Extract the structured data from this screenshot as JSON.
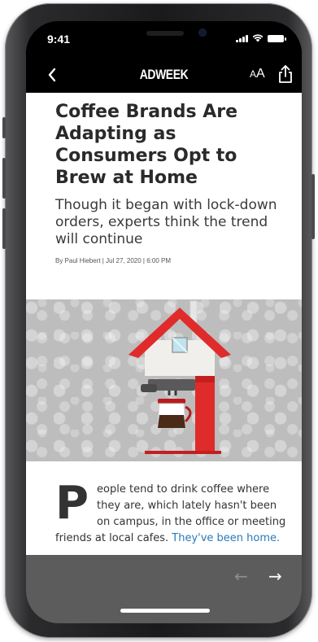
{
  "status_bar": {
    "time": "9:41"
  },
  "nav": {
    "logo": "ADWEEK",
    "text_size_label_small": "A",
    "text_size_label_large": "A"
  },
  "article": {
    "headline": "Coffee Brands Are Adapting as Consumers Opt to Brew at Home",
    "dek": "Though it began with lock-down orders, experts think the trend will continue",
    "byline": "By Paul Hiebert | Jul 27, 2020 | 6:00 PM",
    "dropcap": "P",
    "body_text": "eople tend to drink coffee where they are, which lately hasn't been on campus, in the office or meeting friends at local cafes.",
    "link_text": "They've been home."
  },
  "footer": {
    "prev_icon": "←",
    "next_icon": "→"
  },
  "colors": {
    "accent_red": "#e02b2b",
    "link_blue": "#2a7ab8",
    "bar_black": "#000000",
    "bottom_gray": "#5c5c5c"
  },
  "icons": [
    "back-chevron-icon",
    "share-icon",
    "text-size-icon",
    "arrow-left-icon",
    "arrow-right-icon",
    "signal-icon",
    "wifi-icon",
    "battery-icon"
  ]
}
